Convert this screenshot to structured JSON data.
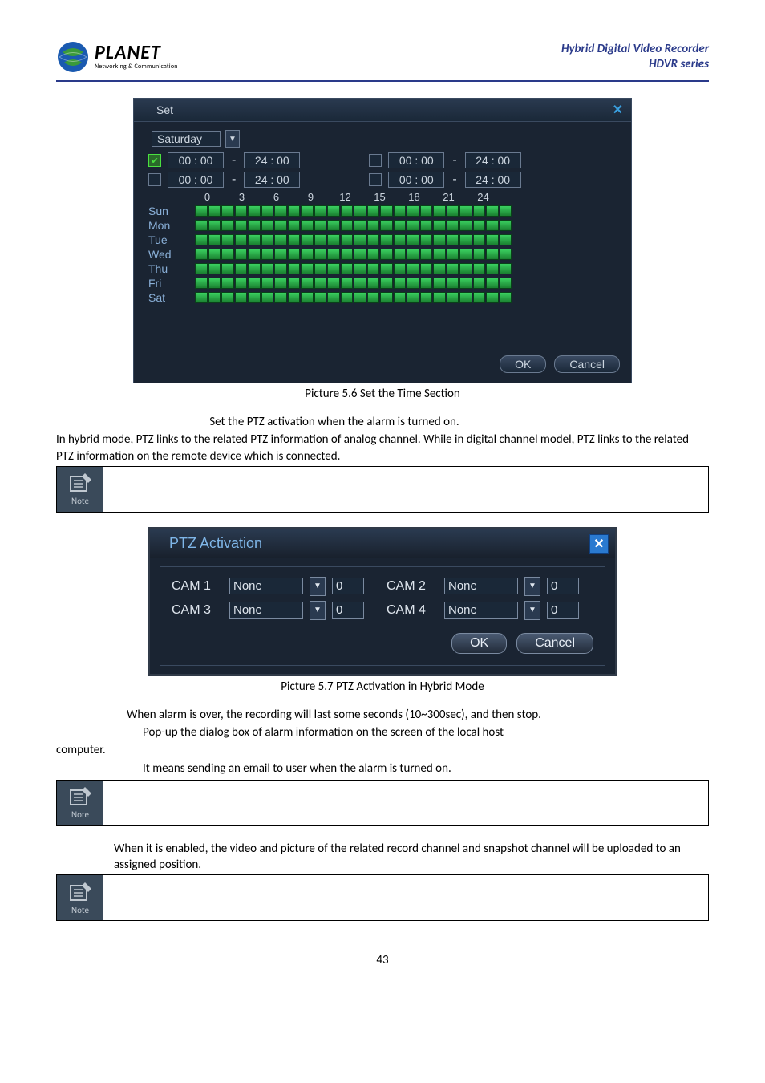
{
  "header": {
    "logo_title": "PLANET",
    "logo_sub": "Networking & Communication",
    "right_line1": "Hybrid Digital Video Recorder",
    "right_line2": "HDVR series"
  },
  "set_dialog": {
    "title": "Set",
    "day_selected": "Saturday",
    "rows": [
      {
        "checked": true,
        "start": "00 : 00",
        "end": "24 : 00",
        "checked2": false,
        "start2": "00 : 00",
        "end2": "24 : 00"
      },
      {
        "checked": false,
        "start": "00 : 00",
        "end": "24 : 00",
        "checked2": false,
        "start2": "00 : 00",
        "end2": "24 : 00"
      }
    ],
    "scale": [
      "0",
      "3",
      "6",
      "9",
      "12",
      "15",
      "18",
      "21",
      "24"
    ],
    "days": [
      "Sun",
      "Mon",
      "Tue",
      "Wed",
      "Thu",
      "Fri",
      "Sat"
    ],
    "ok": "OK",
    "cancel": "Cancel"
  },
  "caption1": "Picture 5.6 Set the Time Section",
  "para1": "Set the PTZ activation when the alarm is turned on.",
  "para2": "In hybrid mode, PTZ links to the related PTZ information of analog channel. While in digital channel model, PTZ links to the related PTZ information on the remote device which is connected.",
  "note_label": "Note",
  "ptz_dialog": {
    "title": "PTZ Activation",
    "cams": [
      {
        "label": "CAM 1",
        "option": "None",
        "num": "0"
      },
      {
        "label": "CAM 2",
        "option": "None",
        "num": "0"
      },
      {
        "label": "CAM 3",
        "option": "None",
        "num": "0"
      },
      {
        "label": "CAM 4",
        "option": "None",
        "num": "0"
      }
    ],
    "ok": "OK",
    "cancel": "Cancel"
  },
  "caption2": "Picture 5.7 PTZ Activation in Hybrid Mode",
  "para3": "When alarm is over, the recording will last some seconds (10~300sec), and then stop.",
  "para4": "Pop-up the dialog box of alarm information on the screen of the local host",
  "para5": "computer.",
  "para6": "It means sending an email to user when the alarm is turned on.",
  "para7": "When it is enabled, the video and picture of the related record channel and snapshot channel will be uploaded to an assigned position.",
  "page_num": "43"
}
